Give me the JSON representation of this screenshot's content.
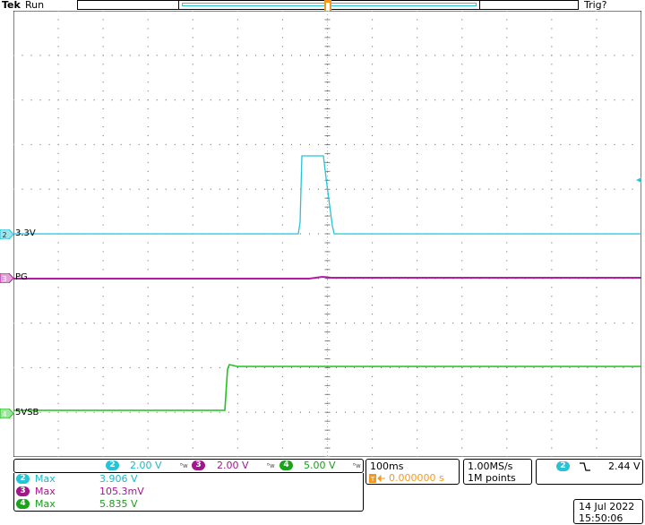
{
  "header": {
    "brand": "Tek",
    "run_state": "Run",
    "trigger_state": "Trig?",
    "trigger_marker": "T"
  },
  "channels": [
    {
      "id": "2",
      "label": "3.3V",
      "color": "#27c3d6"
    },
    {
      "id": "3",
      "label": "PG",
      "color": "#b21ca5"
    },
    {
      "id": "4",
      "label": "5VSB",
      "color": "#1fc21f"
    }
  ],
  "scales": [
    {
      "id": "2",
      "value": "2.00 V"
    },
    {
      "id": "3",
      "value": "2.00 V"
    },
    {
      "id": "4",
      "value": "5.00 V"
    }
  ],
  "measurements": [
    {
      "id": "2",
      "name": "Max",
      "value": "3.906 V"
    },
    {
      "id": "3",
      "name": "Max",
      "value": "105.3mV"
    },
    {
      "id": "4",
      "name": "Max",
      "value": "5.835 V"
    }
  ],
  "timebase": {
    "scale": "100ms",
    "trigger_position": "0.000000 s"
  },
  "acquisition": {
    "sample_rate": "1.00MS/s",
    "record_length": "1M points"
  },
  "trigger": {
    "channel": "2",
    "slope_icon": "falling-edge-icon",
    "level": "2.44 V"
  },
  "datetime": {
    "date": "14 Jul  2022",
    "time": "15:50:06"
  }
}
